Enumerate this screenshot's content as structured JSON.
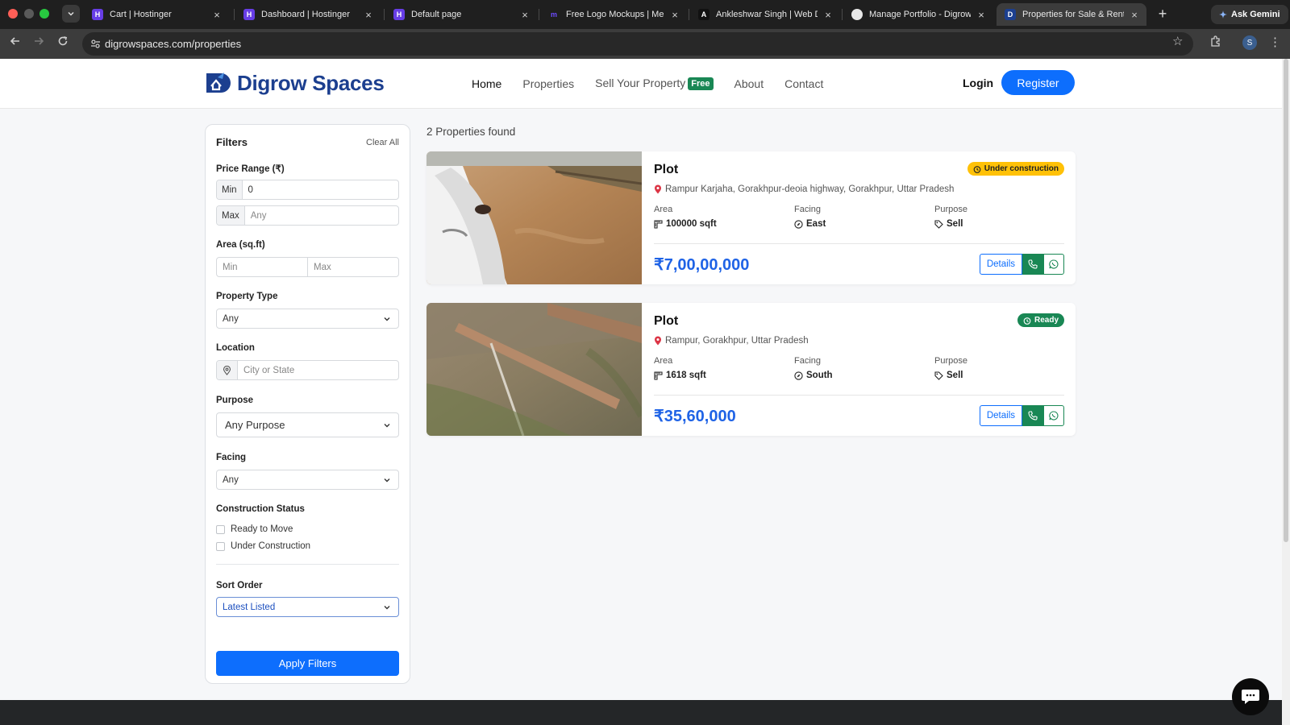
{
  "browser": {
    "tabs": [
      {
        "title": "Cart | Hostinger",
        "favicon": "hostinger-icon",
        "active": false
      },
      {
        "title": "Dashboard | Hostinger",
        "favicon": "hostinger-icon",
        "active": false
      },
      {
        "title": "Default page",
        "favicon": "hostinger-icon",
        "active": false
      },
      {
        "title": "Free Logo Mockups | Media",
        "favicon": "mockup-icon",
        "active": false
      },
      {
        "title": "Ankleshwar Singh | Web De",
        "favicon": "a-letter-icon",
        "active": false
      },
      {
        "title": "Manage Portfolio - Digrow Y",
        "favicon": "avatar-icon",
        "active": false
      },
      {
        "title": "Properties for Sale & Rent |",
        "favicon": "digrow-icon",
        "active": true
      }
    ],
    "ask_gemini_label": "Ask Gemini",
    "url": "digrowspaces.com/properties",
    "profile_initial": "S"
  },
  "site": {
    "brand": "Digrow Spaces",
    "nav": {
      "home": "Home",
      "properties": "Properties",
      "sell": "Sell Your Property",
      "sell_badge": "Free",
      "about": "About",
      "contact": "Contact"
    },
    "login_label": "Login",
    "register_label": "Register"
  },
  "filters": {
    "title": "Filters",
    "clear_all": "Clear All",
    "price_label": "Price Range (₹)",
    "price_min_addon": "Min",
    "price_min_value": "0",
    "price_max_addon": "Max",
    "price_max_placeholder": "Any",
    "area_label": "Area (sq.ft)",
    "area_min_placeholder": "Min",
    "area_max_placeholder": "Max",
    "property_type_label": "Property Type",
    "property_type_value": "Any",
    "location_label": "Location",
    "location_placeholder": "City or State",
    "purpose_label": "Purpose",
    "purpose_value": "Any Purpose",
    "facing_label": "Facing",
    "facing_value": "Any",
    "construction_label": "Construction Status",
    "ready_label": "Ready to Move",
    "under_label": "Under Construction",
    "sort_label": "Sort Order",
    "sort_value": "Latest Listed",
    "apply_label": "Apply Filters"
  },
  "results": {
    "count_text": "2 Properties found",
    "spec_labels": {
      "area": "Area",
      "facing": "Facing",
      "purpose": "Purpose"
    },
    "details_label": "Details",
    "listings": [
      {
        "title": "Plot",
        "status": "Under construction",
        "status_color": "#ffc107",
        "location": "Rampur Karjaha, Gorakhpur-deoia highway, Gorakhpur, Uttar Pradesh",
        "area": "100000 sqft",
        "facing": "East",
        "purpose": "Sell",
        "price": "₹7,00,00,000"
      },
      {
        "title": "Plot",
        "status": "Ready",
        "status_color": "#198754",
        "location": "Rampur, Gorakhpur, Uttar Pradesh",
        "area": "1618 sqft",
        "facing": "South",
        "purpose": "Sell",
        "price": "₹35,60,000"
      }
    ]
  },
  "colors": {
    "brand_blue": "#1c3f8f",
    "primary": "#0d6efd",
    "price_blue": "#1f63e6",
    "success": "#198754",
    "warning": "#ffc107"
  }
}
